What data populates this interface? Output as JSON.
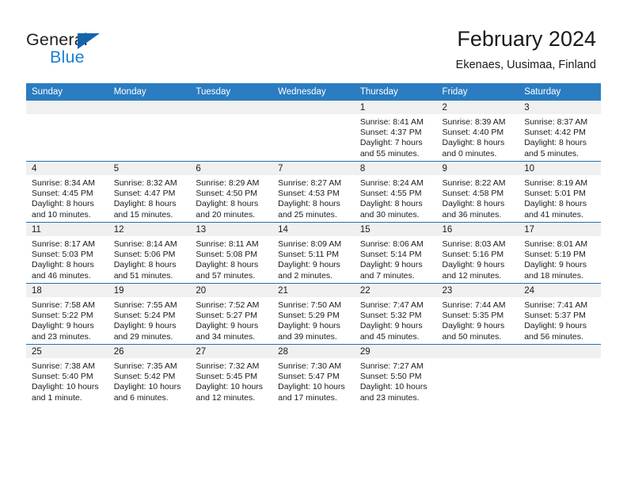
{
  "brand": {
    "name_part1": "General",
    "name_part2": "Blue",
    "triangle_color": "#1464aa",
    "blue_color": "#1a7fd4"
  },
  "header": {
    "month_title": "February 2024",
    "location": "Ekenaes, Uusimaa, Finland"
  },
  "theme": {
    "header_bg": "#2b7cc0",
    "row_divider": "#2b6ca8",
    "daynum_bg": "#f0f0f0"
  },
  "weekday_headers": [
    "Sunday",
    "Monday",
    "Tuesday",
    "Wednesday",
    "Thursday",
    "Friday",
    "Saturday"
  ],
  "weeks": [
    [
      {
        "day": "",
        "empty": true
      },
      {
        "day": "",
        "empty": true
      },
      {
        "day": "",
        "empty": true
      },
      {
        "day": "",
        "empty": true
      },
      {
        "day": "1",
        "sunrise": "Sunrise: 8:41 AM",
        "sunset": "Sunset: 4:37 PM",
        "daylight_line1": "Daylight: 7 hours",
        "daylight_line2": "and 55 minutes."
      },
      {
        "day": "2",
        "sunrise": "Sunrise: 8:39 AM",
        "sunset": "Sunset: 4:40 PM",
        "daylight_line1": "Daylight: 8 hours",
        "daylight_line2": "and 0 minutes."
      },
      {
        "day": "3",
        "sunrise": "Sunrise: 8:37 AM",
        "sunset": "Sunset: 4:42 PM",
        "daylight_line1": "Daylight: 8 hours",
        "daylight_line2": "and 5 minutes."
      }
    ],
    [
      {
        "day": "4",
        "sunrise": "Sunrise: 8:34 AM",
        "sunset": "Sunset: 4:45 PM",
        "daylight_line1": "Daylight: 8 hours",
        "daylight_line2": "and 10 minutes."
      },
      {
        "day": "5",
        "sunrise": "Sunrise: 8:32 AM",
        "sunset": "Sunset: 4:47 PM",
        "daylight_line1": "Daylight: 8 hours",
        "daylight_line2": "and 15 minutes."
      },
      {
        "day": "6",
        "sunrise": "Sunrise: 8:29 AM",
        "sunset": "Sunset: 4:50 PM",
        "daylight_line1": "Daylight: 8 hours",
        "daylight_line2": "and 20 minutes."
      },
      {
        "day": "7",
        "sunrise": "Sunrise: 8:27 AM",
        "sunset": "Sunset: 4:53 PM",
        "daylight_line1": "Daylight: 8 hours",
        "daylight_line2": "and 25 minutes."
      },
      {
        "day": "8",
        "sunrise": "Sunrise: 8:24 AM",
        "sunset": "Sunset: 4:55 PM",
        "daylight_line1": "Daylight: 8 hours",
        "daylight_line2": "and 30 minutes."
      },
      {
        "day": "9",
        "sunrise": "Sunrise: 8:22 AM",
        "sunset": "Sunset: 4:58 PM",
        "daylight_line1": "Daylight: 8 hours",
        "daylight_line2": "and 36 minutes."
      },
      {
        "day": "10",
        "sunrise": "Sunrise: 8:19 AM",
        "sunset": "Sunset: 5:01 PM",
        "daylight_line1": "Daylight: 8 hours",
        "daylight_line2": "and 41 minutes."
      }
    ],
    [
      {
        "day": "11",
        "sunrise": "Sunrise: 8:17 AM",
        "sunset": "Sunset: 5:03 PM",
        "daylight_line1": "Daylight: 8 hours",
        "daylight_line2": "and 46 minutes."
      },
      {
        "day": "12",
        "sunrise": "Sunrise: 8:14 AM",
        "sunset": "Sunset: 5:06 PM",
        "daylight_line1": "Daylight: 8 hours",
        "daylight_line2": "and 51 minutes."
      },
      {
        "day": "13",
        "sunrise": "Sunrise: 8:11 AM",
        "sunset": "Sunset: 5:08 PM",
        "daylight_line1": "Daylight: 8 hours",
        "daylight_line2": "and 57 minutes."
      },
      {
        "day": "14",
        "sunrise": "Sunrise: 8:09 AM",
        "sunset": "Sunset: 5:11 PM",
        "daylight_line1": "Daylight: 9 hours",
        "daylight_line2": "and 2 minutes."
      },
      {
        "day": "15",
        "sunrise": "Sunrise: 8:06 AM",
        "sunset": "Sunset: 5:14 PM",
        "daylight_line1": "Daylight: 9 hours",
        "daylight_line2": "and 7 minutes."
      },
      {
        "day": "16",
        "sunrise": "Sunrise: 8:03 AM",
        "sunset": "Sunset: 5:16 PM",
        "daylight_line1": "Daylight: 9 hours",
        "daylight_line2": "and 12 minutes."
      },
      {
        "day": "17",
        "sunrise": "Sunrise: 8:01 AM",
        "sunset": "Sunset: 5:19 PM",
        "daylight_line1": "Daylight: 9 hours",
        "daylight_line2": "and 18 minutes."
      }
    ],
    [
      {
        "day": "18",
        "sunrise": "Sunrise: 7:58 AM",
        "sunset": "Sunset: 5:22 PM",
        "daylight_line1": "Daylight: 9 hours",
        "daylight_line2": "and 23 minutes."
      },
      {
        "day": "19",
        "sunrise": "Sunrise: 7:55 AM",
        "sunset": "Sunset: 5:24 PM",
        "daylight_line1": "Daylight: 9 hours",
        "daylight_line2": "and 29 minutes."
      },
      {
        "day": "20",
        "sunrise": "Sunrise: 7:52 AM",
        "sunset": "Sunset: 5:27 PM",
        "daylight_line1": "Daylight: 9 hours",
        "daylight_line2": "and 34 minutes."
      },
      {
        "day": "21",
        "sunrise": "Sunrise: 7:50 AM",
        "sunset": "Sunset: 5:29 PM",
        "daylight_line1": "Daylight: 9 hours",
        "daylight_line2": "and 39 minutes."
      },
      {
        "day": "22",
        "sunrise": "Sunrise: 7:47 AM",
        "sunset": "Sunset: 5:32 PM",
        "daylight_line1": "Daylight: 9 hours",
        "daylight_line2": "and 45 minutes."
      },
      {
        "day": "23",
        "sunrise": "Sunrise: 7:44 AM",
        "sunset": "Sunset: 5:35 PM",
        "daylight_line1": "Daylight: 9 hours",
        "daylight_line2": "and 50 minutes."
      },
      {
        "day": "24",
        "sunrise": "Sunrise: 7:41 AM",
        "sunset": "Sunset: 5:37 PM",
        "daylight_line1": "Daylight: 9 hours",
        "daylight_line2": "and 56 minutes."
      }
    ],
    [
      {
        "day": "25",
        "sunrise": "Sunrise: 7:38 AM",
        "sunset": "Sunset: 5:40 PM",
        "daylight_line1": "Daylight: 10 hours",
        "daylight_line2": "and 1 minute."
      },
      {
        "day": "26",
        "sunrise": "Sunrise: 7:35 AM",
        "sunset": "Sunset: 5:42 PM",
        "daylight_line1": "Daylight: 10 hours",
        "daylight_line2": "and 6 minutes."
      },
      {
        "day": "27",
        "sunrise": "Sunrise: 7:32 AM",
        "sunset": "Sunset: 5:45 PM",
        "daylight_line1": "Daylight: 10 hours",
        "daylight_line2": "and 12 minutes."
      },
      {
        "day": "28",
        "sunrise": "Sunrise: 7:30 AM",
        "sunset": "Sunset: 5:47 PM",
        "daylight_line1": "Daylight: 10 hours",
        "daylight_line2": "and 17 minutes."
      },
      {
        "day": "29",
        "sunrise": "Sunrise: 7:27 AM",
        "sunset": "Sunset: 5:50 PM",
        "daylight_line1": "Daylight: 10 hours",
        "daylight_line2": "and 23 minutes."
      },
      {
        "day": "",
        "empty": true
      },
      {
        "day": "",
        "empty": true
      }
    ]
  ]
}
